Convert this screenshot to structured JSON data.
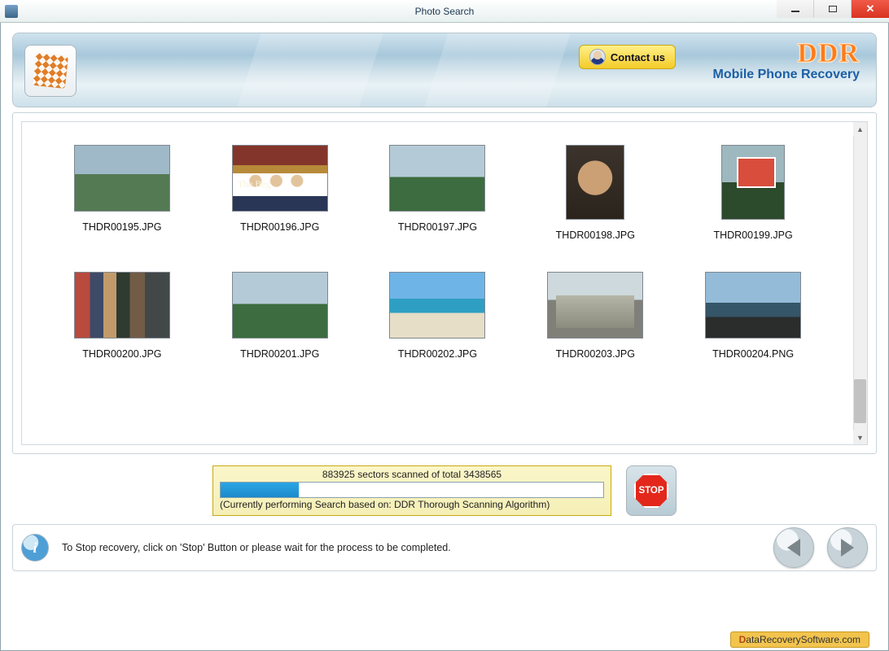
{
  "window": {
    "title": "Photo Search"
  },
  "banner": {
    "contact_label": "Contact us",
    "brand_big": "DDR",
    "brand_sub": "Mobile Phone Recovery"
  },
  "gallery": {
    "items": [
      {
        "filename": "THDR00195.JPG"
      },
      {
        "filename": "THDR00196.JPG"
      },
      {
        "filename": "THDR00197.JPG"
      },
      {
        "filename": "THDR00198.JPG"
      },
      {
        "filename": "THDR00199.JPG"
      },
      {
        "filename": "THDR00200.JPG"
      },
      {
        "filename": "THDR00201.JPG"
      },
      {
        "filename": "THDR00202.JPG"
      },
      {
        "filename": "THDR00203.JPG"
      },
      {
        "filename": "THDR00204.PNG"
      }
    ]
  },
  "progress": {
    "sectors_scanned": 883925,
    "sectors_total": 3438565,
    "top_line": "883925 sectors scanned of total 3438565",
    "sub_line": "(Currently performing Search based on:  DDR Thorough Scanning Algorithm)",
    "percent": 25.7
  },
  "stop": {
    "label": "STOP"
  },
  "info": {
    "text": "To Stop recovery, click on 'Stop' Button or please wait for the process to be completed."
  },
  "watermark": {
    "text": "DataRecoverySoftware.com"
  }
}
